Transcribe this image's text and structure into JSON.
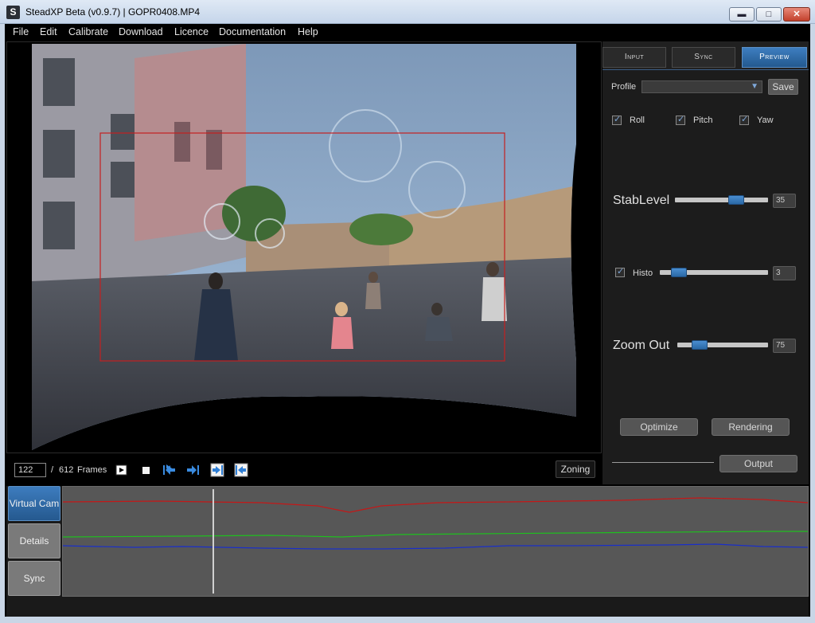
{
  "window": {
    "app_icon": "S",
    "title": "SteadXP Beta (v0.9.7) | GOPR0408.MP4",
    "minimize_glyph": "▬",
    "maximize_glyph": "□",
    "close_glyph": "✕"
  },
  "menu": [
    "File",
    "Edit",
    "Calibrate",
    "Download",
    "Licence",
    "Documentation",
    "Help"
  ],
  "video": {
    "crop_box_color": "#c42020"
  },
  "transport": {
    "current_frame": "122",
    "separator": "/",
    "total_frames": "612",
    "frames_label": "Frames",
    "zoning_label": "Zoning",
    "icons": [
      "clip-icon",
      "stop-icon",
      "skip-start-icon",
      "skip-end-icon",
      "mark-in-icon",
      "mark-out-icon"
    ]
  },
  "panel": {
    "tabs": [
      {
        "label": "Input",
        "active": false
      },
      {
        "label": "Sync",
        "active": false
      },
      {
        "label": "Preview",
        "active": true
      }
    ],
    "profile_label": "Profile",
    "profile_value": "",
    "save_label": "Save",
    "axes": [
      {
        "label": "Roll",
        "checked": true
      },
      {
        "label": "Pitch",
        "checked": true
      },
      {
        "label": "Yaw",
        "checked": true
      }
    ],
    "stablevel": {
      "label": "StabLevel",
      "value": "35"
    },
    "histo": {
      "label": "Histo",
      "checked": true,
      "value": "3"
    },
    "zoom_out": {
      "label": "Zoom Out",
      "value": "75"
    },
    "optimize_label": "Optimize",
    "rendering_label": "Rendering",
    "output_label": "Output"
  },
  "bottom_tabs": [
    {
      "label": "Virtual Cam",
      "active": true
    },
    {
      "label": "Details",
      "active": false
    },
    {
      "label": "Sync",
      "active": false
    }
  ],
  "graph": {
    "series_colors": {
      "roll": "#c41818",
      "pitch": "#1fbf1f",
      "yaw": "#1a2fc9"
    },
    "playhead_color": "#d0d0d0"
  }
}
